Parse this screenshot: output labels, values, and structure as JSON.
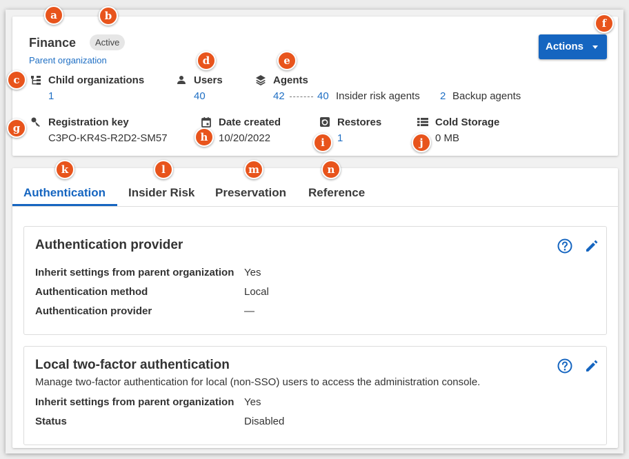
{
  "header": {
    "org_name": "Finance",
    "status": "Active",
    "parent_link": "Parent organization",
    "actions_label": "Actions"
  },
  "stats": {
    "child_orgs": {
      "label": "Child organizations",
      "value": "1",
      "icon": "hierarchy-icon"
    },
    "users": {
      "label": "Users",
      "value": "40",
      "icon": "person-icon"
    },
    "agents": {
      "label": "Agents",
      "total": "42",
      "insider_count": "40",
      "insider_label": "Insider risk agents",
      "backup_count": "2",
      "backup_label": "Backup agents",
      "icon": "layers-icon"
    },
    "registration_key": {
      "label": "Registration key",
      "value": "C3PO-KR4S-R2D2-SM57",
      "icon": "key-icon"
    },
    "date_created": {
      "label": "Date created",
      "value": "10/20/2022",
      "icon": "calendar-icon"
    },
    "restores": {
      "label": "Restores",
      "value": "1",
      "icon": "restore-icon"
    },
    "cold_storage": {
      "label": "Cold Storage",
      "value": "0 MB",
      "icon": "list-icon"
    }
  },
  "tabs": [
    {
      "label": "Authentication",
      "active": true
    },
    {
      "label": "Insider Risk",
      "active": false
    },
    {
      "label": "Preservation",
      "active": false
    },
    {
      "label": "Reference",
      "active": false
    }
  ],
  "auth_provider": {
    "title": "Authentication provider",
    "rows": [
      {
        "label": "Inherit settings from parent organization",
        "value": "Yes"
      },
      {
        "label": "Authentication method",
        "value": "Local"
      },
      {
        "label": "Authentication provider",
        "value": "—"
      }
    ]
  },
  "two_factor": {
    "title": "Local two-factor authentication",
    "description": "Manage two-factor authentication for local (non-SSO) users to access the administration console.",
    "rows": [
      {
        "label": "Inherit settings from parent organization",
        "value": "Yes"
      },
      {
        "label": "Status",
        "value": "Disabled"
      }
    ]
  },
  "callouts": [
    "a",
    "b",
    "c",
    "d",
    "e",
    "f",
    "g",
    "h",
    "i",
    "j",
    "k",
    "l",
    "m",
    "n"
  ],
  "colors": {
    "accent": "#1565c0",
    "link": "#1f6fc4",
    "callout": "#e8541c"
  }
}
